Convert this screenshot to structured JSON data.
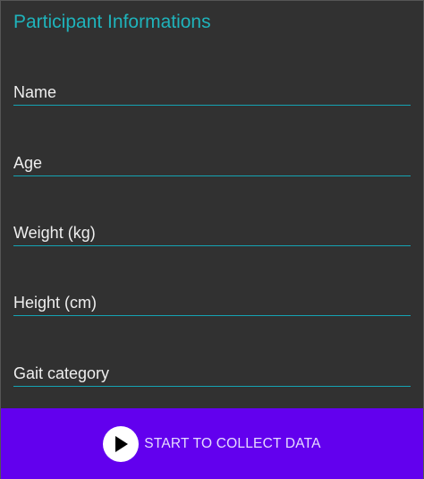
{
  "header": {
    "title": "Participant Informations"
  },
  "form": {
    "fields": [
      {
        "placeholder": "Name",
        "value": ""
      },
      {
        "placeholder": "Age",
        "value": ""
      },
      {
        "placeholder": "Weight (kg)",
        "value": ""
      },
      {
        "placeholder": "Height (cm)",
        "value": ""
      },
      {
        "placeholder": "Gait category",
        "value": ""
      }
    ]
  },
  "action": {
    "label": "START TO COLLECT DATA",
    "icon": "play-icon",
    "color": "#6200ee"
  },
  "colors": {
    "accent": "#1fb3bb",
    "background": "#313131",
    "underline": "#14a3b3"
  }
}
